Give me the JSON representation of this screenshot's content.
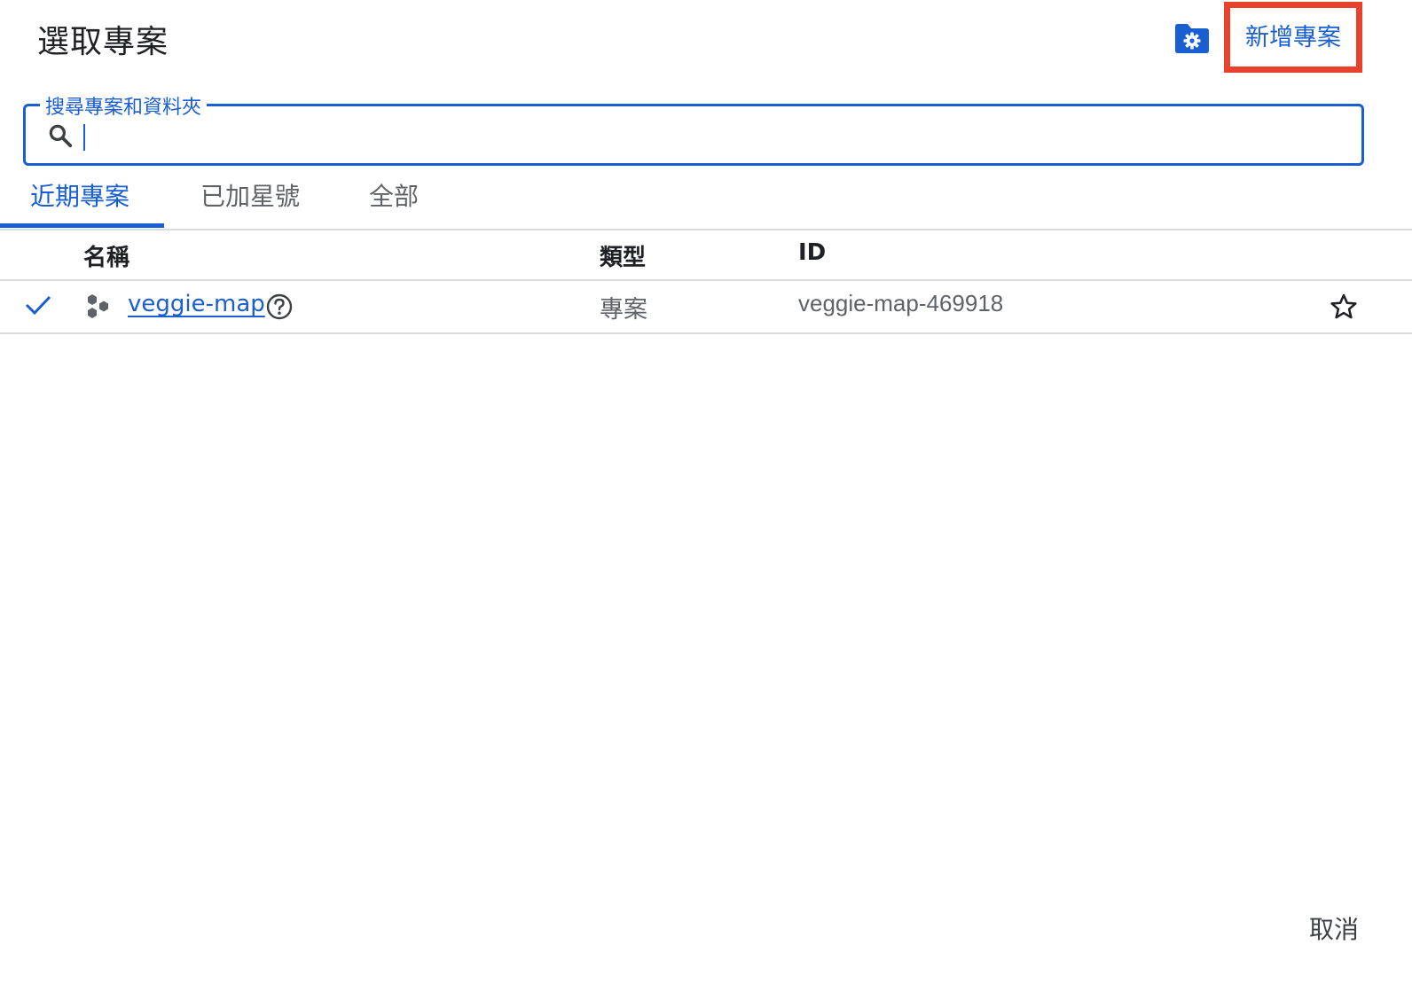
{
  "dialog": {
    "title": "選取專案",
    "new_project_label": "新增專案"
  },
  "icons": {
    "manage": "folder-gear-icon",
    "search": "search-icon",
    "check": "check-icon",
    "project": "project-hexagons-icon",
    "help": "help-circle-icon",
    "star": "star-outline-icon"
  },
  "search": {
    "label": "搜尋專案和資料夾",
    "value": ""
  },
  "tabs": [
    {
      "label": "近期專案",
      "active": true
    },
    {
      "label": "已加星號",
      "active": false
    },
    {
      "label": "全部",
      "active": false
    }
  ],
  "table": {
    "headers": {
      "name": "名稱",
      "type": "類型",
      "id": "ID"
    },
    "rows": [
      {
        "selected": true,
        "name": "veggie-map",
        "type": "專案",
        "id": "veggie-map-469918",
        "starred": false
      }
    ]
  },
  "footer": {
    "cancel_label": "取消"
  },
  "colors": {
    "accent": "#1a5fd1",
    "highlight": "#e8412c",
    "divider": "#dadce0",
    "muted": "#5f6368"
  }
}
